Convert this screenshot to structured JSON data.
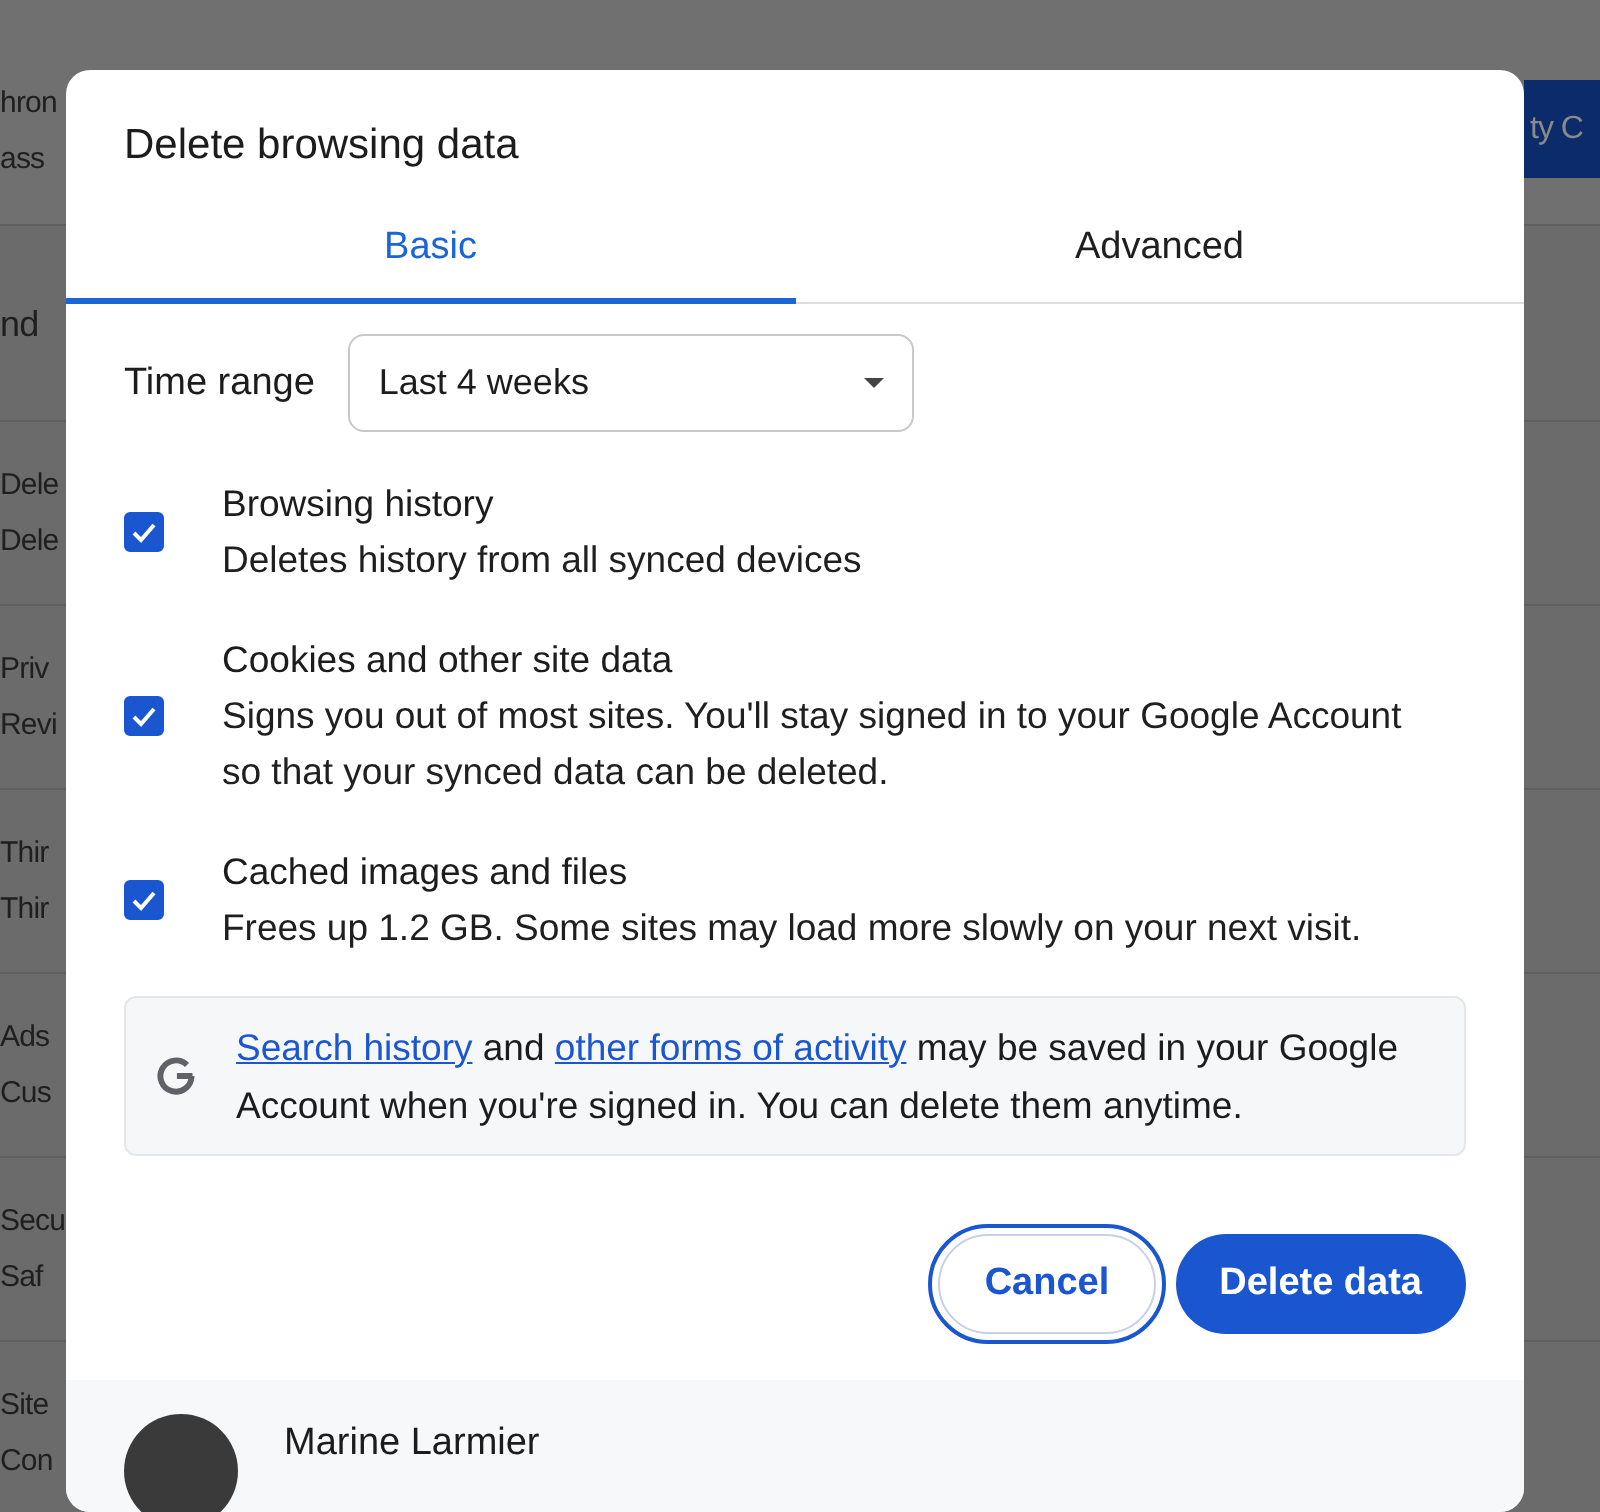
{
  "background_page": {
    "header": {
      "lines": [
        "hron",
        "ass"
      ]
    },
    "section_heading": "nd",
    "rows": [
      {
        "title": "Dele",
        "subtitle": "Dele"
      },
      {
        "title": "Priv",
        "subtitle": "Revi"
      },
      {
        "title": "Thir",
        "subtitle": "Thir"
      },
      {
        "title": "Ads",
        "subtitle": "Cus"
      },
      {
        "title": "Secu",
        "subtitle": "Saf"
      },
      {
        "title": "Site",
        "subtitle": "Con"
      }
    ],
    "header_button": "ty C"
  },
  "dialog": {
    "title": "Delete browsing data",
    "tabs": [
      {
        "label": "Basic",
        "selected": true
      },
      {
        "label": "Advanced",
        "selected": false
      }
    ],
    "time_range": {
      "label": "Time range",
      "value": "Last 4 weeks"
    },
    "options": [
      {
        "label": "Browsing history",
        "description": "Deletes history from all synced devices",
        "checked": true
      },
      {
        "label": "Cookies and other site data",
        "description": "Signs you out of most sites. You'll stay signed in to your Google Account so that your synced data can be deleted.",
        "checked": true
      },
      {
        "label": "Cached images and files",
        "description": "Frees up 1.2 GB. Some sites may load more slowly on your next visit.",
        "checked": true
      }
    ],
    "notice": {
      "link_1": "Search history",
      "text_1": " and ",
      "link_2": "other forms of activity",
      "text_2": " may be saved in your Google Account when you're signed in. You can delete them anytime."
    },
    "buttons": [
      {
        "label": "Cancel",
        "kind": "secondary",
        "focused": true
      },
      {
        "label": "Delete data",
        "kind": "primary",
        "focused": false
      }
    ],
    "account": {
      "name": "Marine Larmier"
    }
  }
}
